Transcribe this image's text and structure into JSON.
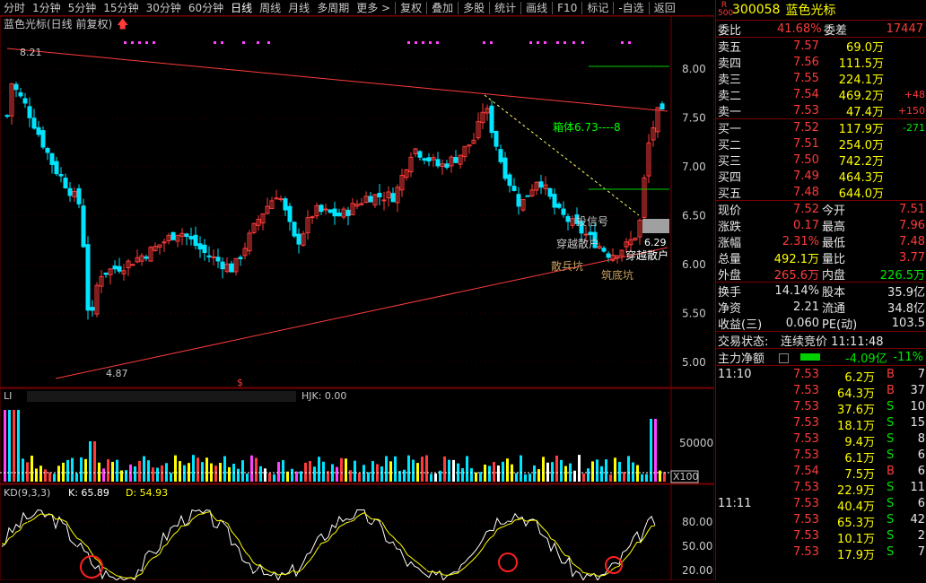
{
  "toolbar": {
    "items": [
      "分时",
      "1分钟",
      "5分钟",
      "15分钟",
      "30分钟",
      "60分钟",
      "日线",
      "周线",
      "月线",
      "多周期",
      "更多 >",
      "复权",
      "叠加",
      "多股",
      "统计",
      "画线",
      "F10",
      "标记",
      "-自选",
      "返回"
    ],
    "selected": "日线"
  },
  "chart": {
    "title": "蓝色光标(日线 前复权)",
    "price_ticks": [
      "8.00",
      "7.50",
      "7.00",
      "6.50",
      "6.00",
      "5.50",
      "5.00"
    ],
    "max_label": "8.21",
    "min_label": "4.87",
    "last_low_label": "6.29",
    "annotations": [
      "箱体6.73----8",
      "投信号",
      "穿越散户",
      "散兵坑",
      "穿越散户",
      "筑底坑"
    ],
    "volume_title": "LI",
    "volume_indicator": "HJK: 0.00",
    "volume_tick": "50000",
    "volume_unit": "X100",
    "kd_title": "KD(9,3,3)",
    "kd_k": "K: 65.89",
    "kd_d": "D: 54.93",
    "kd_ticks": [
      "80.00",
      "50.00",
      "20.00"
    ],
    "colors": {
      "up": "#ff3b3b",
      "down": "#00e5ff",
      "trend": "#ff3b3b",
      "k": "#ffffff",
      "d": "#ffff00"
    }
  },
  "quote": {
    "badge": "R 500",
    "code": "300058",
    "name": "蓝色光标",
    "weibi_label": "委比",
    "weibi": "41.68%",
    "weicha_label": "委差",
    "weicha": "17447",
    "asks": [
      {
        "label": "卖五",
        "price": "7.57",
        "vol": "69.0万",
        "chg": ""
      },
      {
        "label": "卖四",
        "price": "7.56",
        "vol": "111.5万",
        "chg": ""
      },
      {
        "label": "卖三",
        "price": "7.55",
        "vol": "224.1万",
        "chg": ""
      },
      {
        "label": "卖二",
        "price": "7.54",
        "vol": "469.2万",
        "chg": "+48"
      },
      {
        "label": "卖一",
        "price": "7.53",
        "vol": "47.4万",
        "chg": "+150"
      }
    ],
    "bids": [
      {
        "label": "买一",
        "price": "7.52",
        "vol": "117.9万",
        "chg": "-271"
      },
      {
        "label": "买二",
        "price": "7.51",
        "vol": "254.0万",
        "chg": ""
      },
      {
        "label": "买三",
        "price": "7.50",
        "vol": "742.2万",
        "chg": ""
      },
      {
        "label": "买四",
        "price": "7.49",
        "vol": "464.3万",
        "chg": ""
      },
      {
        "label": "买五",
        "price": "7.48",
        "vol": "644.0万",
        "chg": ""
      }
    ],
    "stats": [
      {
        "l1": "现价",
        "v1": "7.52",
        "l2": "今开",
        "v2": "7.51"
      },
      {
        "l1": "涨跌",
        "v1": "0.17",
        "l2": "最高",
        "v2": "7.96"
      },
      {
        "l1": "涨幅",
        "v1": "2.31%",
        "l2": "最低",
        "v2": "7.48"
      },
      {
        "l1": "总量",
        "v1": "492.1万",
        "l2": "量比",
        "v2": "3.77"
      },
      {
        "l1": "外盘",
        "v1": "265.6万",
        "l2": "内盘",
        "v2": "226.5万"
      }
    ],
    "stats2": [
      {
        "l1": "换手",
        "v1": "14.14%",
        "l2": "股本",
        "v2": "35.9亿"
      },
      {
        "l1": "净资",
        "v1": "2.21",
        "l2": "流通",
        "v2": "34.8亿"
      },
      {
        "l1": "收益(三)",
        "v1": "0.060",
        "l2": "PE(动)",
        "v2": "103.5"
      }
    ],
    "trade_status_label": "交易状态:",
    "trade_status": "连续竞价 11:11:48",
    "main_flow_label": "主力净额",
    "main_flow": "-4.09亿",
    "main_flow_pct": "-11%"
  },
  "ticks": [
    {
      "time": "11:10",
      "price": "7.53",
      "vol": "6.2万",
      "bs": "B",
      "n": "7"
    },
    {
      "time": "",
      "price": "7.53",
      "vol": "64.3万",
      "bs": "B",
      "n": "37"
    },
    {
      "time": "",
      "price": "7.53",
      "vol": "37.6万",
      "bs": "S",
      "n": "10"
    },
    {
      "time": "",
      "price": "7.53",
      "vol": "18.1万",
      "bs": "S",
      "n": "15"
    },
    {
      "time": "",
      "price": "7.53",
      "vol": "9.4万",
      "bs": "S",
      "n": "8"
    },
    {
      "time": "",
      "price": "7.53",
      "vol": "6.1万",
      "bs": "S",
      "n": "6"
    },
    {
      "time": "",
      "price": "7.54",
      "vol": "7.5万",
      "bs": "B",
      "n": "6"
    },
    {
      "time": "",
      "price": "7.53",
      "vol": "22.9万",
      "bs": "S",
      "n": "11"
    },
    {
      "time": "11:11",
      "price": "7.53",
      "vol": "40.4万",
      "bs": "S",
      "n": "6"
    },
    {
      "time": "",
      "price": "7.53",
      "vol": "65.3万",
      "bs": "S",
      "n": "42"
    },
    {
      "time": "",
      "price": "7.53",
      "vol": "10.1万",
      "bs": "S",
      "n": "2"
    },
    {
      "time": "",
      "price": "7.53",
      "vol": "17.9万",
      "bs": "S",
      "n": "7"
    }
  ]
}
